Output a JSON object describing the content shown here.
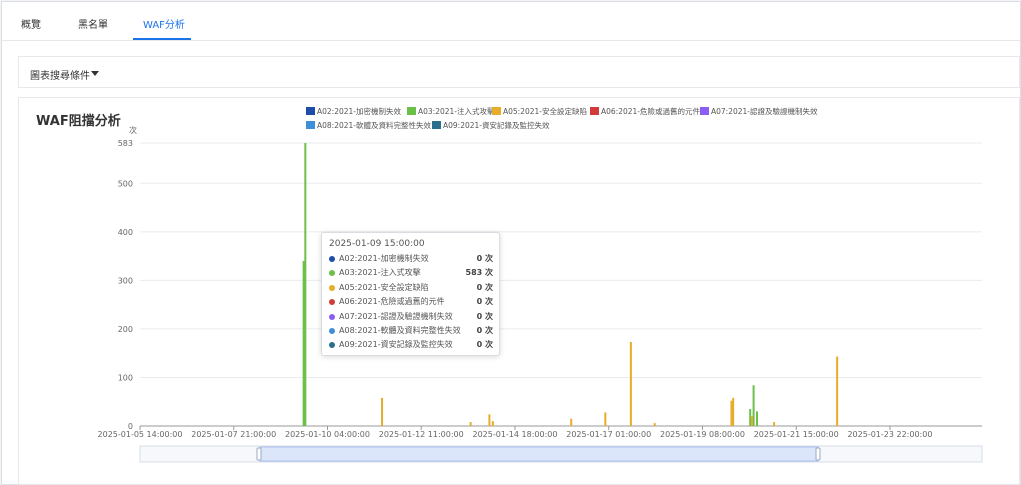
{
  "tabs": [
    "概覽",
    "黑名單",
    "WAF分析"
  ],
  "filter": {
    "label": "圖表搜尋條件"
  },
  "panel": {
    "title": "WAF阻擋分析"
  },
  "colors": {
    "A02": "#1f4eaa",
    "A03": "#6cc04a",
    "A05": "#e8ac2a",
    "A06": "#d23b3b",
    "A07": "#8b5cf6",
    "A08": "#3c8fd8",
    "A09": "#2a6f8e"
  },
  "tooltip": {
    "title": "2025-01-09 15:00:00",
    "rows": [
      {
        "name": "A02:2021-加密機制失效",
        "value": "0 次"
      },
      {
        "name": "A03:2021-注入式攻擊",
        "value": "583 次"
      },
      {
        "name": "A05:2021-安全設定缺陷",
        "value": "0 次"
      },
      {
        "name": "A06:2021-危險或過舊的元件",
        "value": "0 次"
      },
      {
        "name": "A07:2021-認證及驗證機制失效",
        "value": "0 次"
      },
      {
        "name": "A08:2021-軟體及資料完整性失效",
        "value": "0 次"
      },
      {
        "name": "A09:2021-資安記錄及監控失效",
        "value": "0 次"
      }
    ]
  },
  "chart_data": {
    "type": "bar",
    "title": "WAF阻擋分析",
    "ylabel": "次",
    "ylim": [
      0,
      583
    ],
    "yticks": [
      0,
      100,
      200,
      300,
      400,
      500,
      583
    ],
    "xlim": [
      "2025-01-05 14:00:00",
      "2025-01-26 04:00:00"
    ],
    "xticks": [
      "2025-01-05 14:00:00",
      "2025-01-07 21:00:00",
      "2025-01-10 04:00:00",
      "2025-01-12 11:00:00",
      "2025-01-14 18:00:00",
      "2025-01-17 01:00:00",
      "2025-01-19 08:00:00",
      "2025-01-21 15:00:00",
      "2025-01-23 22:00:00"
    ],
    "grid": true,
    "legend_position": "top",
    "series": [
      {
        "name": "A02:2021-加密機制失效",
        "color_key": "A02",
        "points": []
      },
      {
        "name": "A03:2021-注入式攻擊",
        "color_key": "A03",
        "points": [
          [
            "2025-01-09 14:00:00",
            340
          ],
          [
            "2025-01-09 15:00:00",
            583
          ],
          [
            "2025-01-20 14:00:00",
            84
          ],
          [
            "2025-01-20 12:00:00",
            35
          ],
          [
            "2025-01-20 16:00:00",
            30
          ]
        ]
      },
      {
        "name": "A05:2021-安全設定缺陷",
        "color_key": "A05",
        "points": [
          [
            "2025-01-11 12:00:00",
            58
          ],
          [
            "2025-01-13 16:00:00",
            8
          ],
          [
            "2025-01-14 03:00:00",
            24
          ],
          [
            "2025-01-14 05:00:00",
            10
          ],
          [
            "2025-01-16 03:00:00",
            15
          ],
          [
            "2025-01-16 23:00:00",
            28
          ],
          [
            "2025-01-17 14:00:00",
            173
          ],
          [
            "2025-01-18 04:00:00",
            6
          ],
          [
            "2025-01-20 01:00:00",
            52
          ],
          [
            "2025-01-20 02:00:00",
            58
          ],
          [
            "2025-01-20 13:00:00",
            20
          ],
          [
            "2025-01-21 02:00:00",
            8
          ],
          [
            "2025-01-22 15:00:00",
            143
          ]
        ]
      },
      {
        "name": "A06:2021-危險或過舊的元件",
        "color_key": "A06",
        "points": []
      },
      {
        "name": "A07:2021-認證及驗證機制失效",
        "color_key": "A07",
        "points": []
      },
      {
        "name": "A08:2021-軟體及資料完整性失效",
        "color_key": "A08",
        "points": []
      },
      {
        "name": "A09:2021-資安記錄及監控失效",
        "color_key": "A09",
        "points": []
      }
    ]
  }
}
